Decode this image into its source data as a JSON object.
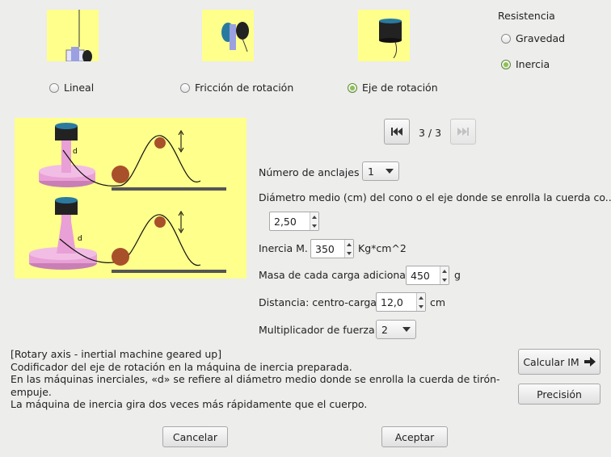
{
  "modes": {
    "options": [
      {
        "label": "Lineal",
        "selected": false
      },
      {
        "label": "Fricción de rotación",
        "selected": false
      },
      {
        "label": "Eje de rotación",
        "selected": true
      }
    ]
  },
  "resistance": {
    "title": "Resistencia",
    "options": [
      {
        "label": "Gravedad",
        "selected": false
      },
      {
        "label": "Inercia",
        "selected": true
      }
    ]
  },
  "pager": {
    "text": "3 / 3",
    "first_icon": "skip-first-icon",
    "last_icon": "skip-last-icon"
  },
  "form": {
    "anchors_label": "Número de anclajes",
    "anchors_value": "1",
    "diameter_label": "Diámetro medio (cm) del cono o el eje donde se enrolla la cuerda co...",
    "diameter_value": "2,50",
    "inertia_label": "Inercia M.",
    "inertia_value": "350",
    "inertia_unit": "Kg*cm^2",
    "mass_label": "Masa de cada carga adicional",
    "mass_value": "450",
    "mass_unit": "g",
    "distance_label": "Distancia: centro-carga",
    "distance_value": "12,0",
    "distance_unit": "cm",
    "multiplier_label": "Multiplicador de fuerza",
    "multiplier_value": "2"
  },
  "description": {
    "line1": "[Rotary axis - inertial machine geared up]",
    "line2": "Codificador del eje de rotación en la máquina de inercia preparada.",
    "line3": "En las máquinas inerciales, «d» se refiere al diámetro medio donde se enrolla la cuerda de tirón-",
    "line4": "empuje.",
    "line5": "La máquina de inercia gira dos veces más rápidamente que el cuerpo."
  },
  "buttons": {
    "calc": "Calcular IM",
    "precision": "Precisión",
    "cancel": "Cancelar",
    "accept": "Aceptar"
  },
  "diagram": {
    "label_d_top": "d",
    "label_d_bottom": "d"
  },
  "colors": {
    "thumb_bg": "#ffff8c",
    "radio_on": "#8cc152",
    "cone": "#e9a0d6",
    "ball": "#a8502a"
  }
}
